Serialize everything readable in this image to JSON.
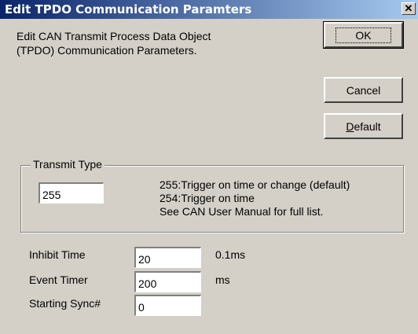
{
  "window": {
    "title": "Edit TPDO Communication Paramters",
    "close_glyph": "✕",
    "close_icon": "close-icon"
  },
  "description": {
    "line1": "Edit CAN Transmit Process Data Object",
    "line2": "(TPDO) Communication Parameters."
  },
  "buttons": {
    "ok_label": "OK",
    "cancel_label": "Cancel",
    "default_label_mnemonic": "D",
    "default_label_rest": "efault"
  },
  "transmit_type": {
    "group_label": "Transmit Type",
    "value": "255",
    "notes": [
      "255:Trigger on time or change (default)",
      "254:Trigger on time",
      "See CAN User Manual for full list."
    ]
  },
  "fields": [
    {
      "label": "Inhibit Time",
      "value": "20",
      "unit": "0.1ms"
    },
    {
      "label": "Event Timer",
      "value": "200",
      "unit": "ms"
    },
    {
      "label": "Starting Sync#",
      "value": "0",
      "unit": ""
    }
  ]
}
